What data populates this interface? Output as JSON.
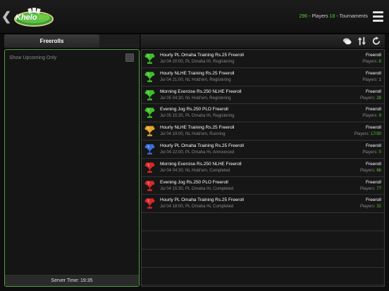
{
  "header": {
    "logo_text_a": "Khelo",
    "logo_text_b": "365",
    "players_count": "296",
    "players_label": " - Players ",
    "tournaments_count": "18",
    "tournaments_label": " - Tournaments"
  },
  "left": {
    "tab_label": "Freerolls",
    "upcoming_label": "Show Upcoming Only",
    "server_time": "Server Time: 19:35"
  },
  "colors": {
    "accent_green": "#5ec93b",
    "trophy_green": "#3fbf2c",
    "trophy_gold": "#e0a62a",
    "trophy_blue": "#3a6fd8",
    "trophy_red": "#d8282a"
  },
  "tournaments": [
    {
      "name": "Hourly PL Omaha Training Rs.25 Freeroll",
      "details": "Jul 04 20:00, PL Omaha Hi, Registering",
      "type": "Freeroll",
      "players_label": "Players: ",
      "players": "8",
      "trophy": "green"
    },
    {
      "name": "Hourly NLHE Training Rs.25 Freeroll",
      "details": "Jul 04 21:00, NL Hold'em, Registering",
      "type": "Freeroll",
      "players_label": "Players: ",
      "players": "1",
      "trophy": "green"
    },
    {
      "name": "Morning Exercise Rs.250 NLHE Freeroll",
      "details": "Jul 05 04:30, NL Hold'em, Registering",
      "type": "Freeroll",
      "players_label": "Players: ",
      "players": "28",
      "trophy": "green"
    },
    {
      "name": "Evening Jog Rs.250 PLO Freeroll",
      "details": "Jul 05 15:30, PL Omaha Hi, Registering",
      "type": "Freeroll",
      "players_label": "Players: ",
      "players": "9",
      "trophy": "green"
    },
    {
      "name": "Hourly NLHE Training Rs.25 Freeroll",
      "details": "Jul 04 19:00, NL Hold'em, Running",
      "type": "Freeroll",
      "players_label": "Players: ",
      "players": "17/30",
      "trophy": "gold"
    },
    {
      "name": "Hourly PL Omaha Training Rs.25 Freeroll",
      "details": "Jul 04 22:00, PL Omaha Hi, Announced",
      "type": "Freeroll",
      "players_label": "Players: ",
      "players": "0",
      "trophy": "blue"
    },
    {
      "name": "Morning Exercise Rs.250 NLHE Freeroll",
      "details": "Jul 04 04:30, NL Hold'em, Completed",
      "type": "Freeroll",
      "players_label": "Players: ",
      "players": "86",
      "trophy": "red"
    },
    {
      "name": "Evening Jog Rs.250 PLO Freeroll",
      "details": "Jul 04 15:30, PL Omaha Hi, Completed",
      "type": "Freeroll",
      "players_label": "Players: ",
      "players": "77",
      "trophy": "red"
    },
    {
      "name": "Hourly PL Omaha Training Rs.25 Freeroll",
      "details": "Jul 04 18:00, PL Omaha Hi, Completed",
      "type": "Freeroll",
      "players_label": "Players: ",
      "players": "32",
      "trophy": "red"
    }
  ],
  "empty_rows": 4
}
